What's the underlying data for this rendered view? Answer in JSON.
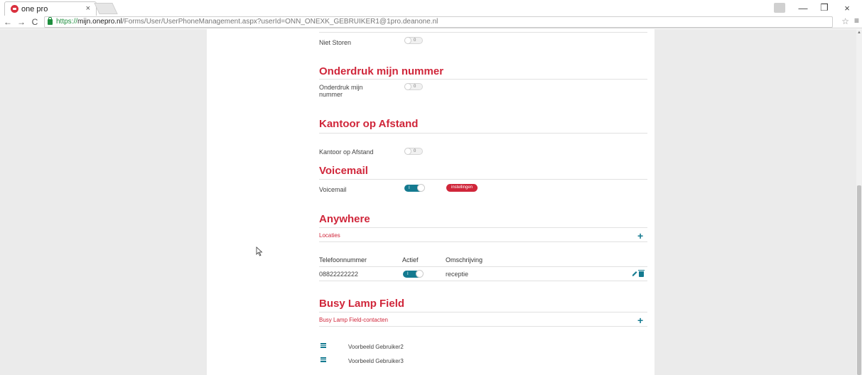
{
  "browser": {
    "tab_title": "one pro",
    "tab_close": "×",
    "url_scheme": "https://",
    "url_host": "mijn.onepro.nl",
    "url_path": "/Forms/User/UserPhoneManagement.aspx?userId=ONN_ONEXK_GEBRUIKER1@1pro.deanone.nl",
    "nav_back": "←",
    "nav_forward": "→",
    "nav_reload": "C",
    "star": "☆",
    "menu": "≡",
    "win_min": "—",
    "win_max": "❐",
    "win_close": "×"
  },
  "niet_storen": {
    "label": "Niet Storen",
    "toggle_state": "0"
  },
  "onderdruk": {
    "title": "Onderdruk mijn nummer",
    "label_line1": "Onderdruk mijn",
    "label_line2": "nummer",
    "toggle_state": "0"
  },
  "kantoor": {
    "title": "Kantoor op Afstand",
    "label": "Kantoor op Afstand",
    "toggle_state": "0"
  },
  "voicemail": {
    "title": "Voicemail",
    "label": "Voicemail",
    "toggle_state": "I",
    "settings_button": "instellingen"
  },
  "anywhere": {
    "title": "Anywhere",
    "locations_link": "Locaties",
    "add": "+",
    "columns": [
      "Telefoonnummer",
      "Actief",
      "Omschrijving"
    ],
    "rows": [
      {
        "number": "08822222222",
        "active_state": "I",
        "description": "receptie"
      }
    ]
  },
  "blf": {
    "title": "Busy Lamp Field",
    "contacts_link": "Busy Lamp Field-contacten",
    "add": "+",
    "contacts": [
      "Voorbeeld Gebruiker2",
      "Voorbeeld Gebruiker3"
    ]
  },
  "colors": {
    "accent_red": "#d0263a",
    "accent_teal": "#147a90",
    "page_bg": "#ebebeb"
  }
}
